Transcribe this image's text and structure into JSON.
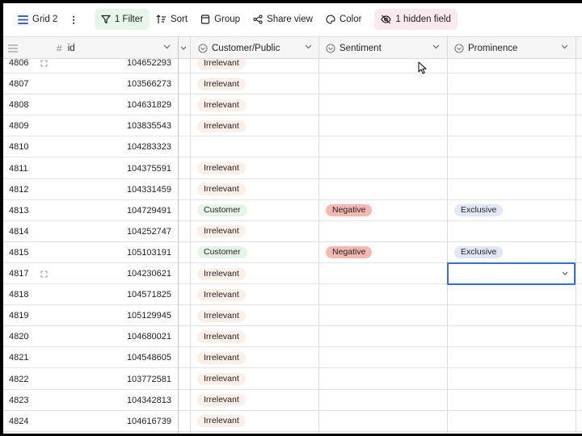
{
  "toolbar": {
    "view_name": "Grid 2",
    "filter_label": "1 Filter",
    "sort_label": "Sort",
    "group_label": "Group",
    "share_label": "Share view",
    "color_label": "Color",
    "hidden_label": "1 hidden field",
    "more_glyph": "⋮"
  },
  "columns": {
    "id": "id",
    "customer": "Customer/Public",
    "sentiment": "Sentiment",
    "prominence": "Prominence",
    "id_type_glyph": "#"
  },
  "colors": {
    "irrelevant_bg": "#fcefe8",
    "customer_bg": "#e6f5e9",
    "negative_bg": "#f4b8b3",
    "exclusive_bg": "#e1e7f7",
    "filter_bg": "#e7f6ea",
    "hidden_bg": "#fbe9ef",
    "selection_border": "#3a6fd0"
  },
  "rows": [
    {
      "num": "4806",
      "id": "104652293",
      "customer": "Irrelevant",
      "sentiment": "",
      "prominence": ""
    },
    {
      "num": "4807",
      "id": "103566273",
      "customer": "Irrelevant",
      "sentiment": "",
      "prominence": ""
    },
    {
      "num": "4808",
      "id": "104631829",
      "customer": "Irrelevant",
      "sentiment": "",
      "prominence": ""
    },
    {
      "num": "4809",
      "id": "103835543",
      "customer": "Irrelevant",
      "sentiment": "",
      "prominence": ""
    },
    {
      "num": "4810",
      "id": "104283323",
      "customer": "",
      "sentiment": "",
      "prominence": ""
    },
    {
      "num": "4811",
      "id": "104375591",
      "customer": "Irrelevant",
      "sentiment": "",
      "prominence": ""
    },
    {
      "num": "4812",
      "id": "104331459",
      "customer": "Irrelevant",
      "sentiment": "",
      "prominence": ""
    },
    {
      "num": "4813",
      "id": "104729491",
      "customer": "Customer",
      "sentiment": "Negative",
      "prominence": "Exclusive"
    },
    {
      "num": "4814",
      "id": "104252747",
      "customer": "Irrelevant",
      "sentiment": "",
      "prominence": ""
    },
    {
      "num": "4815",
      "id": "105103191",
      "customer": "Customer",
      "sentiment": "Negative",
      "prominence": "Exclusive"
    },
    {
      "num": "4817",
      "id": "104230621",
      "customer": "Irrelevant",
      "sentiment": "",
      "prominence": ""
    },
    {
      "num": "4818",
      "id": "104571825",
      "customer": "Irrelevant",
      "sentiment": "",
      "prominence": ""
    },
    {
      "num": "4819",
      "id": "105129945",
      "customer": "Irrelevant",
      "sentiment": "",
      "prominence": ""
    },
    {
      "num": "4820",
      "id": "104680021",
      "customer": "Irrelevant",
      "sentiment": "",
      "prominence": ""
    },
    {
      "num": "4821",
      "id": "104548605",
      "customer": "Irrelevant",
      "sentiment": "",
      "prominence": ""
    },
    {
      "num": "4822",
      "id": "103772581",
      "customer": "Irrelevant",
      "sentiment": "",
      "prominence": ""
    },
    {
      "num": "4823",
      "id": "104342813",
      "customer": "Irrelevant",
      "sentiment": "",
      "prominence": ""
    },
    {
      "num": "4824",
      "id": "104616739",
      "customer": "Irrelevant",
      "sentiment": "",
      "prominence": ""
    }
  ]
}
